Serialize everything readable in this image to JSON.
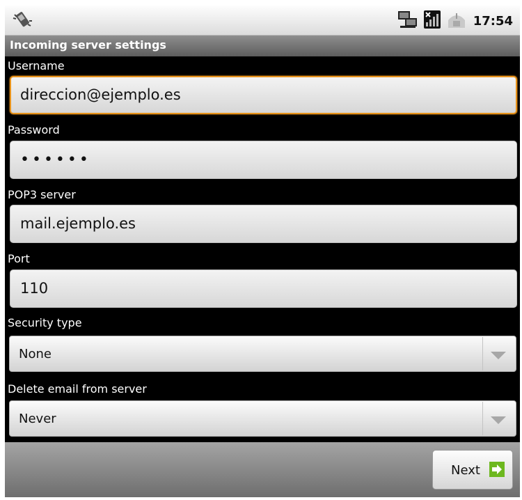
{
  "status_bar": {
    "time": "17:54"
  },
  "title": "Incoming server settings",
  "form": {
    "username": {
      "label": "Username",
      "value": "direccion@ejemplo.es"
    },
    "password": {
      "label": "Password",
      "value": "••••••"
    },
    "server": {
      "label": "POP3 server",
      "value": "mail.ejemplo.es"
    },
    "port": {
      "label": "Port",
      "value": "110"
    },
    "security_type": {
      "label": "Security type",
      "selected": "None"
    },
    "delete_policy": {
      "label": "Delete email from server",
      "selected": "Never"
    }
  },
  "actions": {
    "next_label": "Next"
  },
  "colors": {
    "focus": "#e8931b",
    "next_icon": "#6db81f"
  },
  "icons": [
    "phone-vibrate-icon",
    "network-sync-icon",
    "no-sim-signal-icon",
    "usb-connection-icon",
    "next-arrow-icon",
    "dropdown-arrow-icon"
  ]
}
